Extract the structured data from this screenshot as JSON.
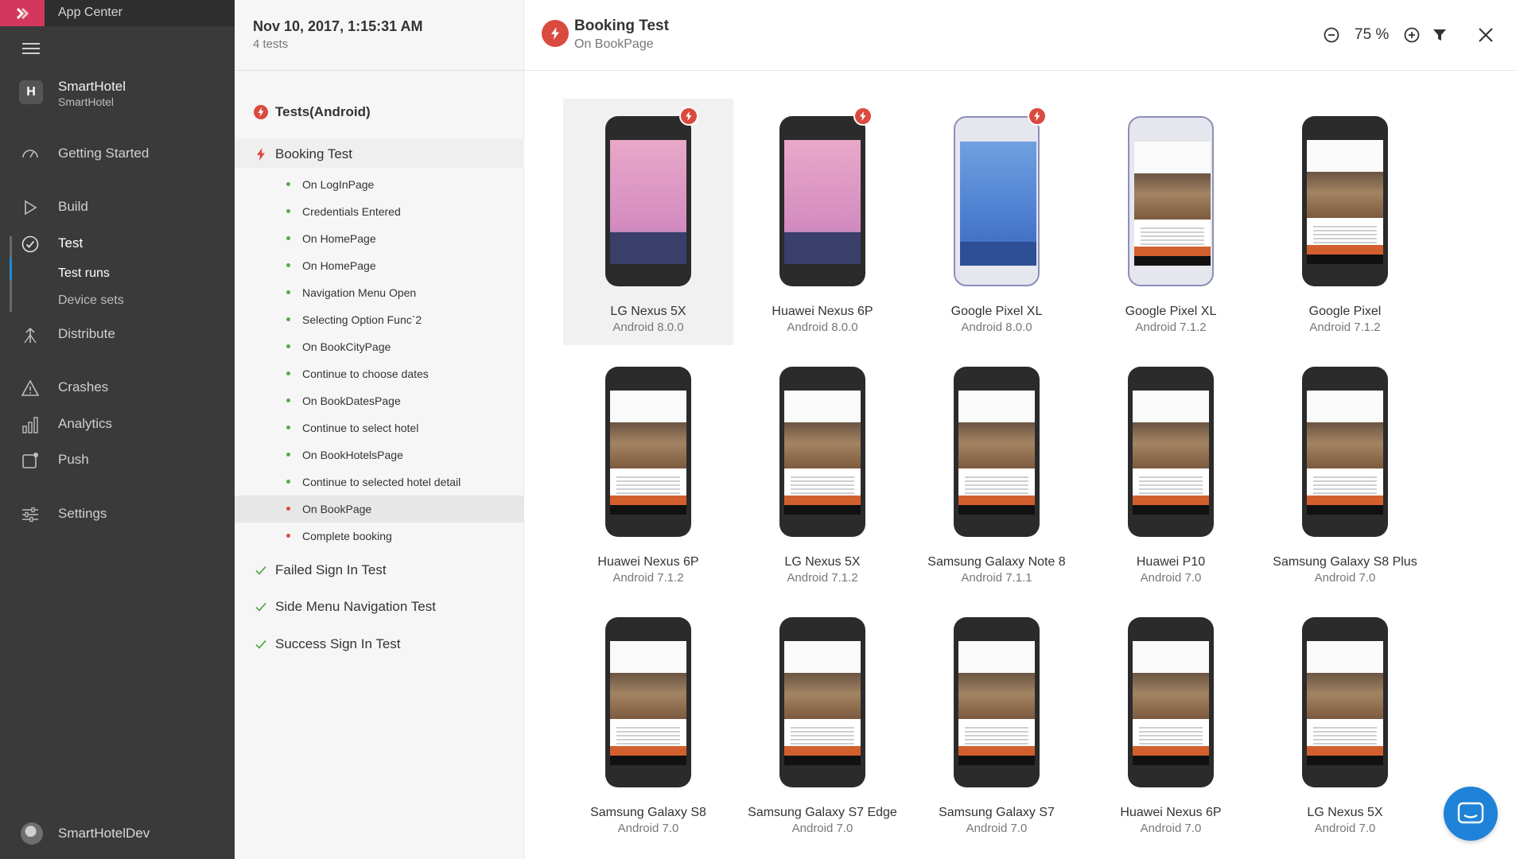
{
  "app": {
    "title": "App Center",
    "brand_color": "#d3385c"
  },
  "org": {
    "name": "SmartHotel",
    "sub": "SmartHotel"
  },
  "nav": {
    "getting_started": "Getting Started",
    "build": "Build",
    "test": "Test",
    "test_runs": "Test runs",
    "device_sets": "Device sets",
    "distribute": "Distribute",
    "crashes": "Crashes",
    "analytics": "Analytics",
    "push": "Push",
    "settings": "Settings"
  },
  "user": {
    "name": "SmartHotelDev"
  },
  "run": {
    "date": "Nov 10, 2017, 1:15:31 AM",
    "count": "4 tests"
  },
  "tree": {
    "group": "Tests(Android)",
    "booking": "Booking Test",
    "steps": [
      {
        "label": "On LogInPage",
        "status": "passed"
      },
      {
        "label": "Credentials Entered",
        "status": "passed"
      },
      {
        "label": "On HomePage",
        "status": "passed"
      },
      {
        "label": "On HomePage",
        "status": "passed"
      },
      {
        "label": "Navigation Menu Open",
        "status": "passed"
      },
      {
        "label": "Selecting Option Func`2",
        "status": "passed"
      },
      {
        "label": "On BookCityPage",
        "status": "passed"
      },
      {
        "label": "Continue to choose dates",
        "status": "passed"
      },
      {
        "label": "On BookDatesPage",
        "status": "passed"
      },
      {
        "label": "Continue to select hotel",
        "status": "passed"
      },
      {
        "label": "On BookHotelsPage",
        "status": "passed"
      },
      {
        "label": "Continue to selected hotel detail",
        "status": "passed"
      },
      {
        "label": "On BookPage",
        "status": "failed"
      },
      {
        "label": "Complete booking",
        "status": "failed"
      }
    ],
    "other_tests": [
      "Failed Sign In Test",
      "Side Menu Navigation Test",
      "Success Sign In Test"
    ]
  },
  "main": {
    "title": "Booking Test",
    "subtitle": "On BookPage",
    "zoom": "75 %"
  },
  "devices": [
    {
      "name": "LG Nexus 5X",
      "os": "Android 8.0.0",
      "screen": "pink",
      "failed": true,
      "selected": true,
      "frame": "dark"
    },
    {
      "name": "Huawei Nexus 6P",
      "os": "Android 8.0.0",
      "screen": "pink",
      "failed": true,
      "selected": false,
      "frame": "dark"
    },
    {
      "name": "Google Pixel XL",
      "os": "Android 8.0.0",
      "screen": "blue",
      "failed": true,
      "selected": false,
      "frame": "light"
    },
    {
      "name": "Google Pixel XL",
      "os": "Android 7.1.2",
      "screen": "app",
      "failed": false,
      "selected": false,
      "frame": "light"
    },
    {
      "name": "Google Pixel",
      "os": "Android 7.1.2",
      "screen": "app",
      "failed": false,
      "selected": false,
      "frame": "dark"
    },
    {
      "name": "Huawei Nexus 6P",
      "os": "Android 7.1.2",
      "screen": "app",
      "failed": false,
      "selected": false,
      "frame": "dark"
    },
    {
      "name": "LG Nexus 5X",
      "os": "Android 7.1.2",
      "screen": "app",
      "failed": false,
      "selected": false,
      "frame": "dark"
    },
    {
      "name": "Samsung Galaxy Note 8",
      "os": "Android 7.1.1",
      "screen": "app",
      "failed": false,
      "selected": false,
      "frame": "dark"
    },
    {
      "name": "Huawei P10",
      "os": "Android 7.0",
      "screen": "app",
      "failed": false,
      "selected": false,
      "frame": "dark"
    },
    {
      "name": "Samsung Galaxy S8 Plus",
      "os": "Android 7.0",
      "screen": "app",
      "failed": false,
      "selected": false,
      "frame": "dark"
    },
    {
      "name": "Samsung Galaxy S8",
      "os": "Android 7.0",
      "screen": "app",
      "failed": false,
      "selected": false,
      "frame": "dark"
    },
    {
      "name": "Samsung Galaxy S7 Edge",
      "os": "Android 7.0",
      "screen": "app",
      "failed": false,
      "selected": false,
      "frame": "dark"
    },
    {
      "name": "Samsung Galaxy S7",
      "os": "Android 7.0",
      "screen": "app",
      "failed": false,
      "selected": false,
      "frame": "dark"
    },
    {
      "name": "Huawei Nexus 6P",
      "os": "Android 7.0",
      "screen": "app",
      "failed": false,
      "selected": false,
      "frame": "dark"
    },
    {
      "name": "LG Nexus 5X",
      "os": "Android 7.0",
      "screen": "app",
      "failed": false,
      "selected": false,
      "frame": "dark"
    }
  ],
  "colors": {
    "failed": "#d94b3e",
    "passed": "#59a84b",
    "accent": "#1e83d8"
  }
}
